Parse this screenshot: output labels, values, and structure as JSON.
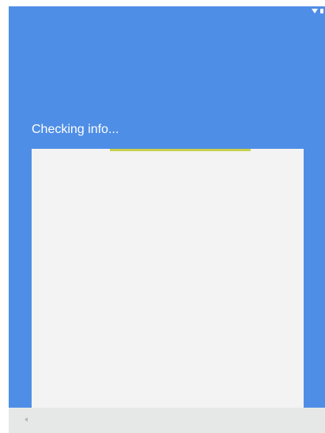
{
  "app": {
    "title": "Checking info..."
  },
  "progress": {
    "state": "indeterminate",
    "color": "#c9cf4c"
  },
  "status_bar": {
    "icons": [
      "wifi-icon",
      "battery-icon"
    ]
  },
  "navigation_bar": {
    "icons": [
      "back-icon"
    ]
  },
  "colors": {
    "background": "#4f8ee6",
    "card": "#f3f3f3",
    "nav_bar": "#e6e8e8",
    "title_text": "#ffffff"
  }
}
